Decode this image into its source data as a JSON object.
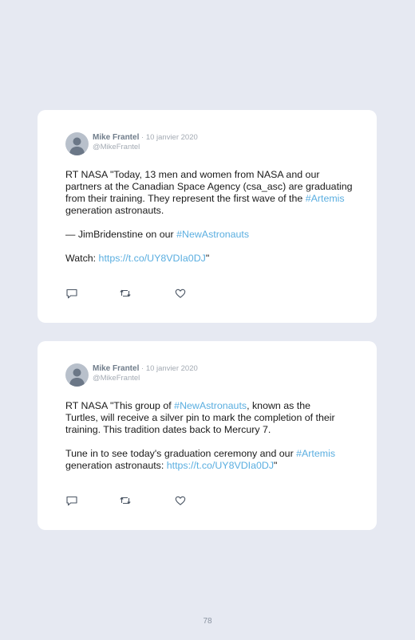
{
  "colors": {
    "background": "#e6e9f2",
    "card": "#ffffff",
    "link": "#5aaee0",
    "author": "#6f7c8a",
    "muted": "#a3aab3"
  },
  "icons": {
    "reply": "comment-icon",
    "retweet": "retweet-icon",
    "like": "heart-icon",
    "avatar": "avatar-person-icon"
  },
  "tweets": [
    {
      "author": "Mike Frantel",
      "separator": " · ",
      "date": "10 janvier 2020",
      "handle": "@MikeFrantel",
      "paragraphs": [
        [
          {
            "text": "RT NASA \"Today, 13 men and women from NASA and our partners at the Canadian Space Agency (csa_asc) are graduating from their training. They represent the first wave of the ",
            "link": false
          },
          {
            "text": "#Artemis",
            "link": true
          },
          {
            "text": " generation astronauts.",
            "link": false
          }
        ],
        [
          {
            "text": "— JimBridenstine on our ",
            "link": false
          },
          {
            "text": "#NewAstronauts",
            "link": true
          }
        ],
        [
          {
            "text": "Watch: ",
            "link": false
          },
          {
            "text": "https://t.co/UY8VDIa0DJ",
            "link": true
          },
          {
            "text": "\"",
            "link": false
          }
        ]
      ]
    },
    {
      "author": "Mike Frantel",
      "separator": " · ",
      "date": "10 janvier 2020",
      "handle": "@MikeFrantel",
      "paragraphs": [
        [
          {
            "text": "RT NASA \"This group of ",
            "link": false
          },
          {
            "text": "#NewAstronauts",
            "link": true
          },
          {
            "text": ", known as the Turtles, will receive a silver pin to mark the completion of their training. This tradition dates back to Mercury 7.",
            "link": false
          }
        ],
        [
          {
            "text": "Tune in to see today's graduation ceremony and our ",
            "link": false
          },
          {
            "text": "#Artemis",
            "link": true
          },
          {
            "text": " generation astronauts: ",
            "link": false
          },
          {
            "text": "https://t.co/UY8VDIa0DJ",
            "link": true
          },
          {
            "text": "\"",
            "link": false
          }
        ]
      ]
    }
  ],
  "page_number": "78"
}
